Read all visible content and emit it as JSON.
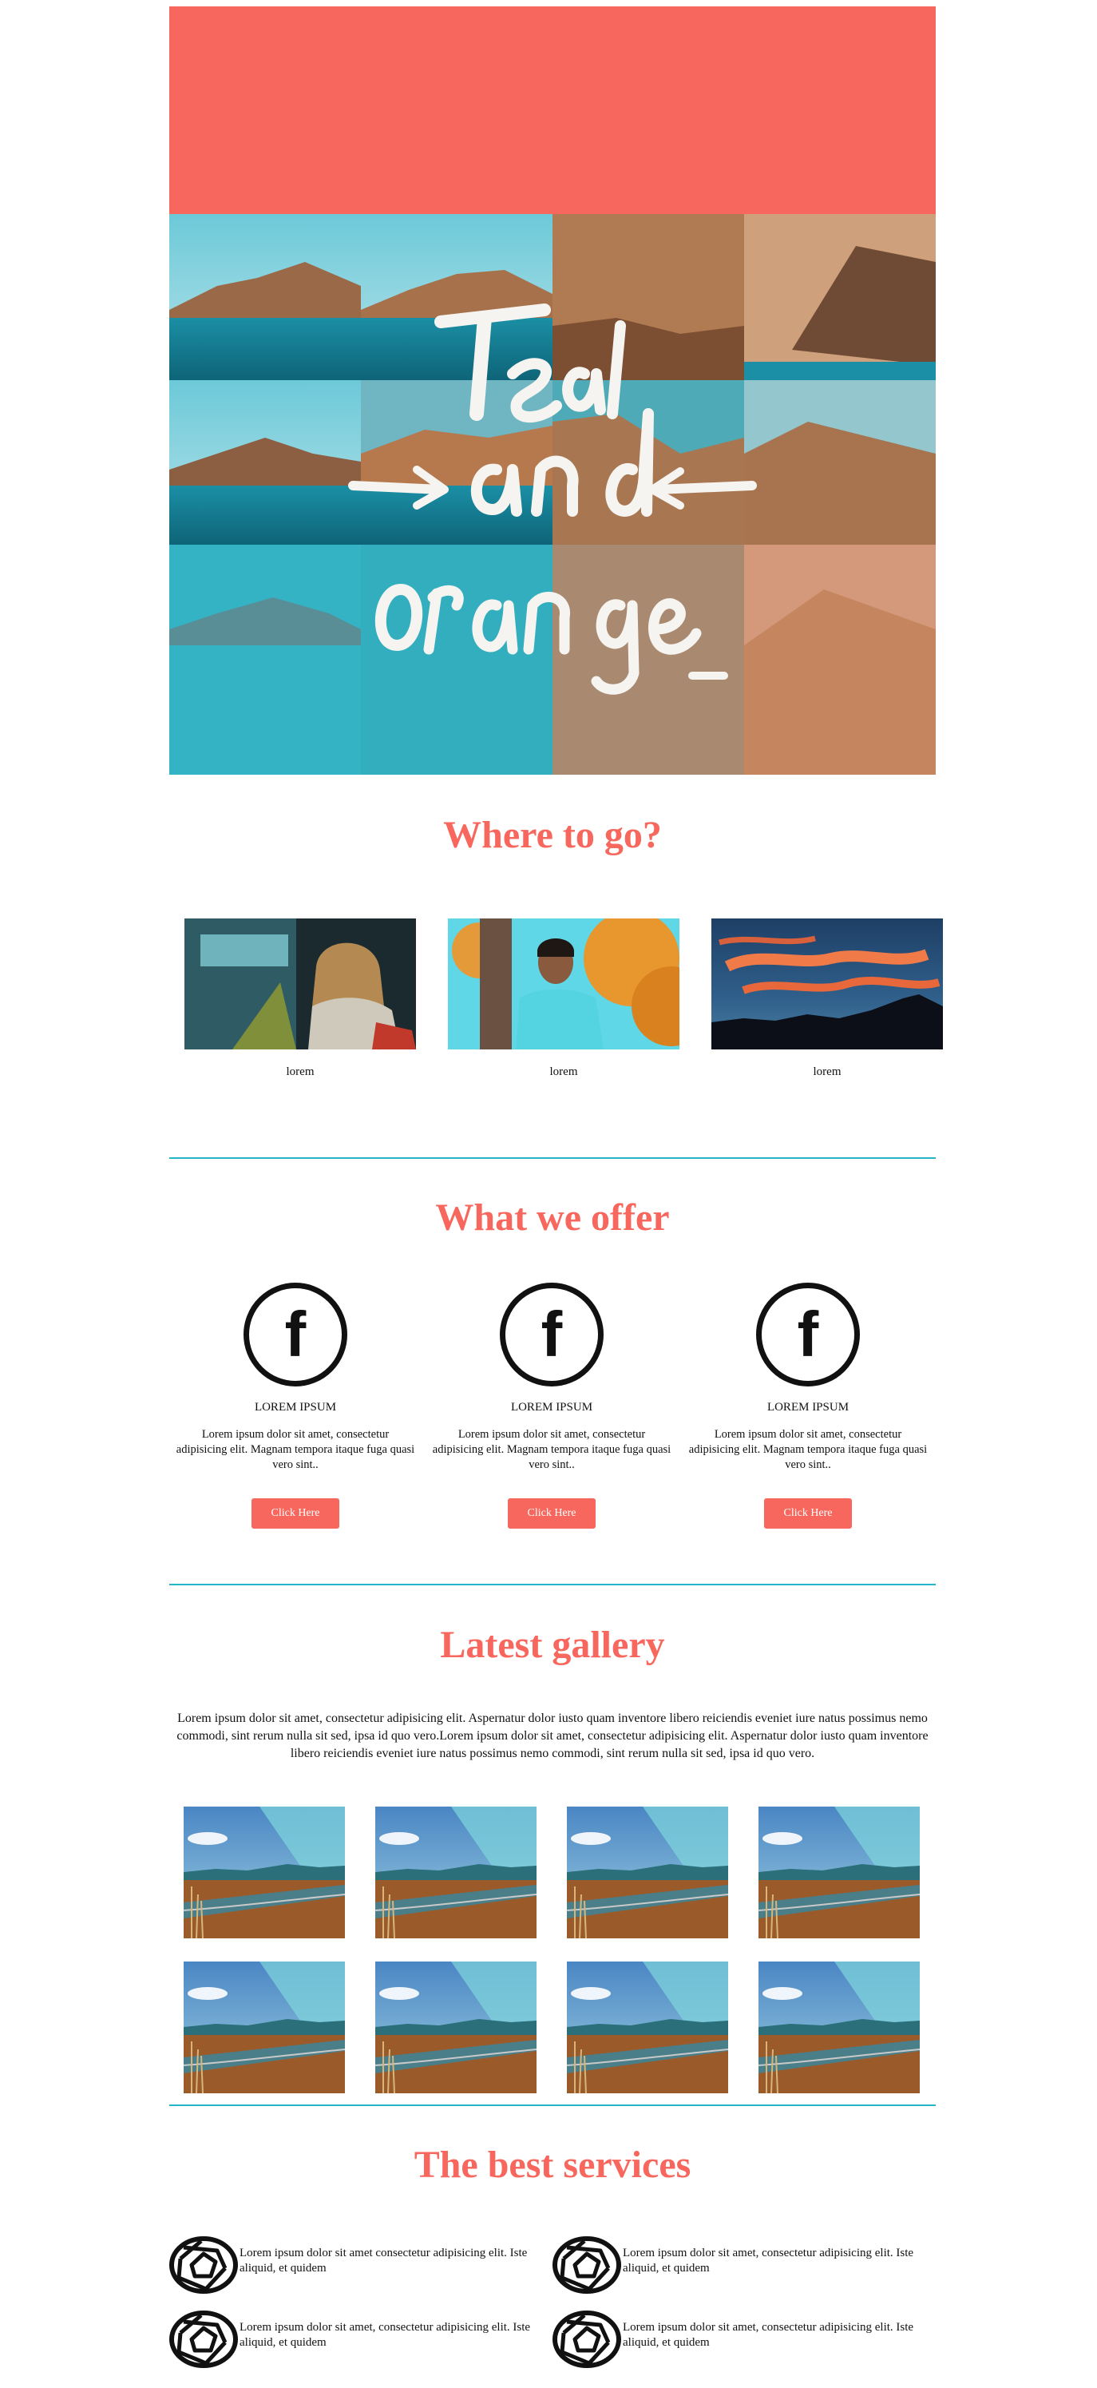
{
  "hero": {
    "title_art": "Teal and orange"
  },
  "where_to_go": {
    "title": "Where to go?",
    "items": [
      {
        "caption": "lorem",
        "image": "woman-with-scarf-photo"
      },
      {
        "caption": "lorem",
        "image": "young-man-by-tree-photo"
      },
      {
        "caption": "lorem",
        "image": "sunset-sky-photo"
      }
    ]
  },
  "what_we_offer": {
    "title": "What we offer",
    "items": [
      {
        "icon": "facebook-icon",
        "title": "LOREM IPSUM",
        "text": "Lorem ipsum dolor sit amet, consectetur adipisicing elit. Magnam tempora itaque fuga quasi vero sint..",
        "button": "Click Here"
      },
      {
        "icon": "facebook-icon",
        "title": "LOREM IPSUM",
        "text": "Lorem ipsum dolor sit amet, consectetur adipisicing elit. Magnam tempora itaque fuga quasi vero sint..",
        "button": "Click Here"
      },
      {
        "icon": "facebook-icon",
        "title": "LOREM IPSUM",
        "text": "Lorem ipsum dolor sit amet, consectetur adipisicing elit. Magnam tempora itaque fuga quasi vero sint..",
        "button": "Click Here"
      }
    ]
  },
  "latest_gallery": {
    "title": "Latest gallery",
    "text": "Lorem ipsum dolor sit amet, consectetur adipisicing elit. Aspernatur dolor iusto quam inventore libero reiciendis eveniet iure natus possimus nemo commodi, sint rerum nulla sit sed, ipsa id quo vero.Lorem ipsum dolor sit amet, consectetur adipisicing elit. Aspernatur dolor iusto quam inventore libero reiciendis eveniet iure natus possimus nemo commodi, sint rerum nulla sit sed, ipsa id quo vero.",
    "image": "road-landscape-photo"
  },
  "best_services": {
    "title": "The best services",
    "items": [
      {
        "icon": "aperture-icon",
        "text": "Lorem ipsum dolor sit amet consectetur adipisicing elit. Iste aliquid, et quidem"
      },
      {
        "icon": "aperture-icon",
        "text": "Lorem ipsum dolor sit amet, consectetur adipisicing elit. Iste aliquid, et quidem"
      },
      {
        "icon": "aperture-icon",
        "text": "Lorem ipsum dolor sit amet, consectetur adipisicing elit. Iste aliquid, et quidem"
      },
      {
        "icon": "aperture-icon",
        "text": "Lorem ipsum dolor sit amet, consectetur adipisicing elit. Iste aliquid, et quidem"
      }
    ]
  },
  "colors": {
    "accent": "#f7675d",
    "divider": "#23b6c7"
  }
}
